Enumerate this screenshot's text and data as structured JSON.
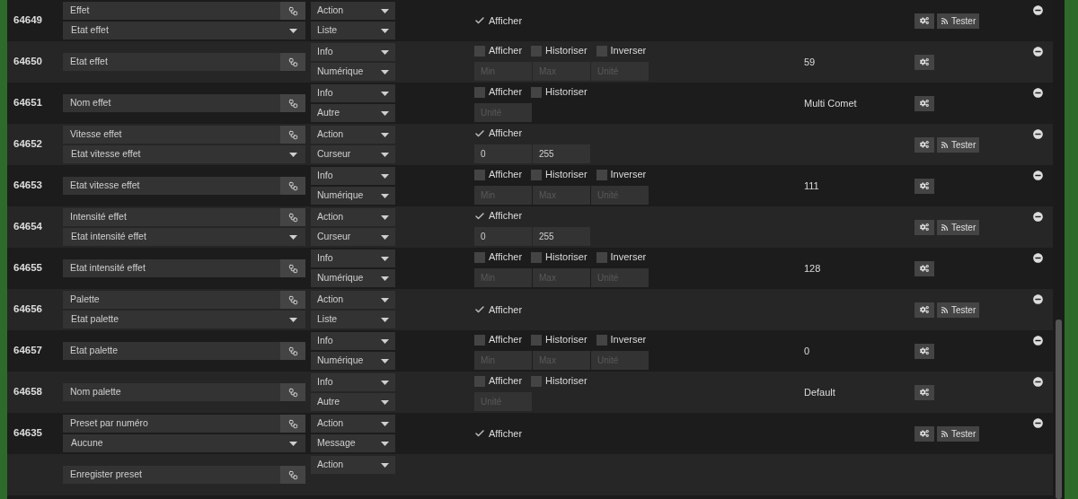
{
  "rows": [
    {
      "id": "64649",
      "name": "Effet",
      "linked": "Etat effet",
      "type": "Action",
      "subtype": "Liste",
      "options": [
        {
          "label": "Afficher",
          "checked": true
        }
      ],
      "fields": [],
      "test_label": "Tester"
    },
    {
      "id": "64650",
      "name": "Etat effet",
      "type": "Info",
      "subtype": "Numérique",
      "options": [
        {
          "label": "Afficher",
          "checked": false
        },
        {
          "label": "Historiser",
          "checked": false
        },
        {
          "label": "Inverser",
          "checked": false
        }
      ],
      "fields": [
        {
          "placeholder": "Min"
        },
        {
          "placeholder": "Max"
        },
        {
          "placeholder": "Unité"
        }
      ],
      "value": "59"
    },
    {
      "id": "64651",
      "name": "Nom effet",
      "type": "Info",
      "subtype": "Autre",
      "options": [
        {
          "label": "Afficher",
          "checked": false
        },
        {
          "label": "Historiser",
          "checked": false
        }
      ],
      "fields": [
        {
          "placeholder": "Unité"
        }
      ],
      "value": "Multi Comet"
    },
    {
      "id": "64652",
      "name": "Vitesse effet",
      "linked": "Etat vitesse effet",
      "type": "Action",
      "subtype": "Curseur",
      "options": [
        {
          "label": "Afficher",
          "checked": true
        }
      ],
      "fields": [
        {
          "value": "0"
        },
        {
          "value": "255"
        }
      ],
      "test_label": "Tester"
    },
    {
      "id": "64653",
      "name": "Etat vitesse effet",
      "type": "Info",
      "subtype": "Numérique",
      "options": [
        {
          "label": "Afficher",
          "checked": false
        },
        {
          "label": "Historiser",
          "checked": false
        },
        {
          "label": "Inverser",
          "checked": false
        }
      ],
      "fields": [
        {
          "placeholder": "Min"
        },
        {
          "placeholder": "Max"
        },
        {
          "placeholder": "Unité"
        }
      ],
      "value": "111"
    },
    {
      "id": "64654",
      "name": "Intensité effet",
      "linked": "Etat intensité effet",
      "type": "Action",
      "subtype": "Curseur",
      "options": [
        {
          "label": "Afficher",
          "checked": true
        }
      ],
      "fields": [
        {
          "value": "0"
        },
        {
          "value": "255"
        }
      ],
      "test_label": "Tester"
    },
    {
      "id": "64655",
      "name": "Etat intensité effet",
      "type": "Info",
      "subtype": "Numérique",
      "options": [
        {
          "label": "Afficher",
          "checked": false
        },
        {
          "label": "Historiser",
          "checked": false
        },
        {
          "label": "Inverser",
          "checked": false
        }
      ],
      "fields": [
        {
          "placeholder": "Min"
        },
        {
          "placeholder": "Max"
        },
        {
          "placeholder": "Unité"
        }
      ],
      "value": "128"
    },
    {
      "id": "64656",
      "name": "Palette",
      "linked": "Etat palette",
      "type": "Action",
      "subtype": "Liste",
      "options": [
        {
          "label": "Afficher",
          "checked": true
        }
      ],
      "fields": [],
      "test_label": "Tester"
    },
    {
      "id": "64657",
      "name": "Etat palette",
      "type": "Info",
      "subtype": "Numérique",
      "options": [
        {
          "label": "Afficher",
          "checked": false
        },
        {
          "label": "Historiser",
          "checked": false
        },
        {
          "label": "Inverser",
          "checked": false
        }
      ],
      "fields": [
        {
          "placeholder": "Min"
        },
        {
          "placeholder": "Max"
        },
        {
          "placeholder": "Unité"
        }
      ],
      "value": "0"
    },
    {
      "id": "64658",
      "name": "Nom palette",
      "type": "Info",
      "subtype": "Autre",
      "options": [
        {
          "label": "Afficher",
          "checked": false
        },
        {
          "label": "Historiser",
          "checked": false
        }
      ],
      "fields": [
        {
          "placeholder": "Unité"
        }
      ],
      "value": "Default"
    },
    {
      "id": "64635",
      "name": "Preset par numéro",
      "linked": "Aucune",
      "type": "Action",
      "subtype": "Message",
      "options": [
        {
          "label": "Afficher",
          "checked": true
        }
      ],
      "fields": [],
      "test_label": "Tester"
    },
    {
      "name": "Enregister preset",
      "type": "Action",
      "options": [],
      "fields": []
    }
  ]
}
